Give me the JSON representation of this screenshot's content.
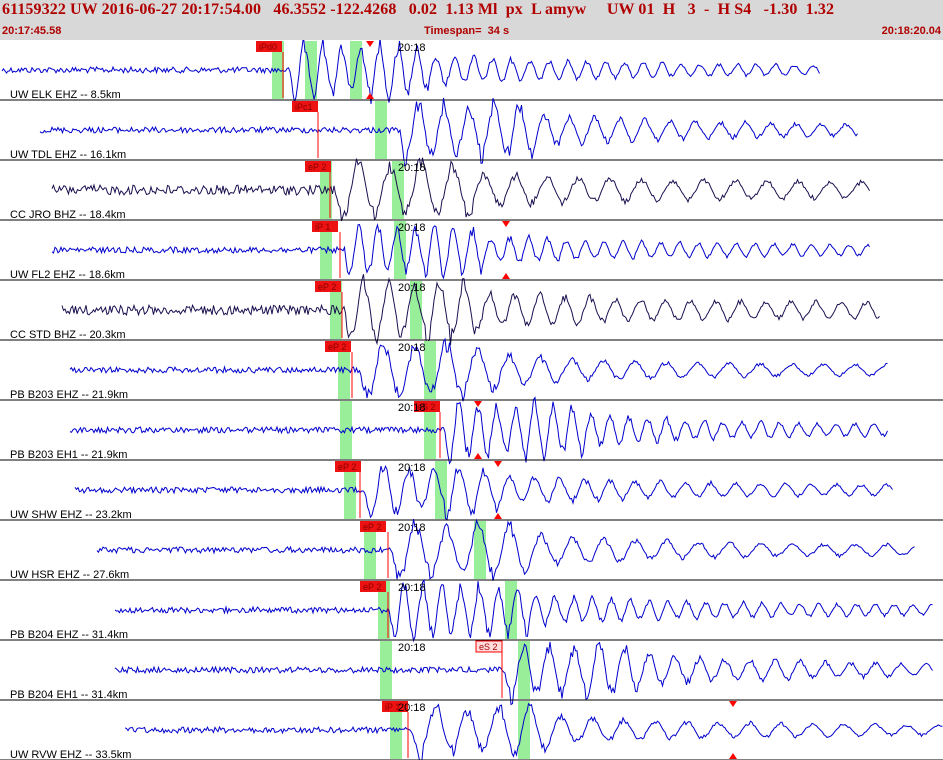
{
  "header": {
    "title": "61159322 UW 2016-06-27 20:17:54.00   46.3552 -122.4268   0.02  1.13 Ml  px  L amyw     UW 01  H   3  -  H S4   -1.30  1.32",
    "start_time": "20:17:45.58",
    "timespan": "Timespan=  34 s",
    "end_time": "20:18:20.04"
  },
  "colors": {
    "header_bg": "#d8d8d8",
    "header_text": "#b00000",
    "trace_blue": "#0000cc",
    "trace_dark": "#1a1050",
    "pick_red": "#ff0000",
    "pick_box": "#ee1111",
    "window_green": "#99ee99",
    "grid": "#000000"
  },
  "traces": [
    {
      "label": "UW ELK EHZ -- 8.5km",
      "color": "blue",
      "time_label": "20:18",
      "picks": [
        {
          "text": "iPd0",
          "style": "filled"
        }
      ],
      "markers": true
    },
    {
      "label": "UW TDL EHZ -- 16.1km",
      "color": "blue",
      "time_label": "",
      "picks": [
        {
          "text": "iPc1",
          "style": "filled"
        }
      ],
      "markers": false
    },
    {
      "label": "CC JRO BHZ -- 18.4km",
      "color": "dark",
      "time_label": "20:18",
      "picks": [
        {
          "text": "eP 2",
          "style": "filled"
        }
      ],
      "markers": false
    },
    {
      "label": "UW FL2 EHZ -- 18.6km",
      "color": "blue",
      "time_label": "20:18",
      "picks": [
        {
          "text": "iP 1",
          "style": "filled"
        }
      ],
      "markers": true
    },
    {
      "label": "CC STD BHZ -- 20.3km",
      "color": "dark",
      "time_label": "20:18",
      "picks": [
        {
          "text": "eP 2",
          "style": "filled"
        }
      ],
      "markers": false
    },
    {
      "label": "PB B203 EHZ -- 21.9km",
      "color": "blue",
      "time_label": "20:18",
      "picks": [
        {
          "text": "eP 2",
          "style": "filled"
        }
      ],
      "markers": false
    },
    {
      "label": "PB B203 EH1 -- 21.9km",
      "color": "blue",
      "time_label": "20:18",
      "picks": [
        {
          "text": "eS 2",
          "style": "filled"
        }
      ],
      "markers": true
    },
    {
      "label": "UW SHW EHZ -- 23.2km",
      "color": "blue",
      "time_label": "20:18",
      "picks": [
        {
          "text": "eP 2",
          "style": "filled"
        }
      ],
      "markers": true
    },
    {
      "label": "UW HSR EHZ -- 27.6km",
      "color": "blue",
      "time_label": "20:18",
      "picks": [
        {
          "text": "eP 2",
          "style": "filled"
        }
      ],
      "markers": false
    },
    {
      "label": "PB B204 EHZ -- 31.4km",
      "color": "blue",
      "time_label": "20:18",
      "picks": [
        {
          "text": "eP 2",
          "style": "filled"
        }
      ],
      "markers": false
    },
    {
      "label": "PB B204 EH1 -- 31.4km",
      "color": "blue",
      "time_label": "20:18",
      "picks": [
        {
          "text": "eS 2",
          "style": "outline"
        }
      ],
      "markers": false
    },
    {
      "label": "UW RVW EHZ -- 33.5km",
      "color": "blue",
      "time_label": "20:18",
      "picks": [
        {
          "text": "iP 1",
          "style": "filled"
        }
      ],
      "markers": true
    }
  ]
}
